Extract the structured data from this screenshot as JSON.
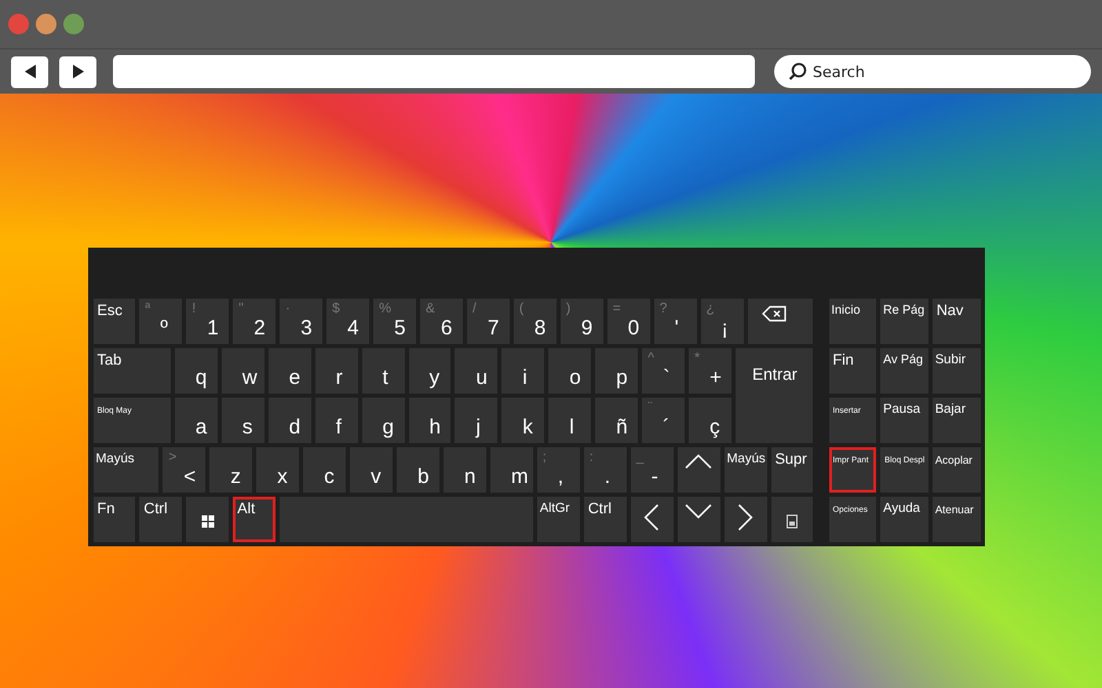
{
  "browser": {
    "search": {
      "placeholder": "Search"
    }
  },
  "keyboard": {
    "main_rows": [
      {
        "keys": [
          {
            "kind": "label",
            "label": "Esc",
            "highlighted": false
          },
          {
            "kind": "char",
            "shift": "ª",
            "main": "º",
            "highlighted": false
          },
          {
            "kind": "char",
            "shift": "!",
            "main": "1",
            "highlighted": false
          },
          {
            "kind": "char",
            "shift": "\"",
            "main": "2",
            "highlighted": false
          },
          {
            "kind": "char",
            "shift": "·",
            "main": "3",
            "highlighted": false
          },
          {
            "kind": "char",
            "shift": "$",
            "main": "4",
            "highlighted": false
          },
          {
            "kind": "char",
            "shift": "%",
            "main": "5",
            "highlighted": false
          },
          {
            "kind": "char",
            "shift": "&",
            "main": "6",
            "highlighted": false
          },
          {
            "kind": "char",
            "shift": "/",
            "main": "7",
            "highlighted": false
          },
          {
            "kind": "char",
            "shift": "(",
            "main": "8",
            "highlighted": false
          },
          {
            "kind": "char",
            "shift": ")",
            "main": "9",
            "highlighted": false
          },
          {
            "kind": "char",
            "shift": "=",
            "main": "0",
            "highlighted": false
          },
          {
            "kind": "char",
            "shift": "?",
            "main": "'",
            "highlighted": false
          },
          {
            "kind": "char",
            "shift": "¿",
            "main": "¡",
            "highlighted": false
          },
          {
            "kind": "backspace",
            "highlighted": false
          }
        ]
      },
      {
        "keys": [
          {
            "kind": "label",
            "label": "Tab",
            "highlighted": false
          },
          {
            "kind": "char",
            "main": "q",
            "highlighted": false
          },
          {
            "kind": "char",
            "main": "w",
            "highlighted": false
          },
          {
            "kind": "char",
            "main": "e",
            "highlighted": false
          },
          {
            "kind": "char",
            "main": "r",
            "highlighted": false
          },
          {
            "kind": "char",
            "main": "t",
            "highlighted": false
          },
          {
            "kind": "char",
            "main": "y",
            "highlighted": false
          },
          {
            "kind": "char",
            "main": "u",
            "highlighted": false
          },
          {
            "kind": "char",
            "main": "i",
            "highlighted": false
          },
          {
            "kind": "char",
            "main": "o",
            "highlighted": false
          },
          {
            "kind": "char",
            "main": "p",
            "highlighted": false
          },
          {
            "kind": "char",
            "shift": "^",
            "main": "`",
            "highlighted": false
          },
          {
            "kind": "char",
            "shift": "*",
            "main": "+",
            "highlighted": false
          },
          {
            "kind": "enter",
            "label": "Entrar",
            "highlighted": false
          }
        ]
      },
      {
        "keys": [
          {
            "kind": "label",
            "label": "Bloq May",
            "highlighted": false
          },
          {
            "kind": "char",
            "main": "a",
            "highlighted": false
          },
          {
            "kind": "char",
            "main": "s",
            "highlighted": false
          },
          {
            "kind": "char",
            "main": "d",
            "highlighted": false
          },
          {
            "kind": "char",
            "main": "f",
            "highlighted": false
          },
          {
            "kind": "char",
            "main": "g",
            "highlighted": false
          },
          {
            "kind": "char",
            "main": "h",
            "highlighted": false
          },
          {
            "kind": "char",
            "main": "j",
            "highlighted": false
          },
          {
            "kind": "char",
            "main": "k",
            "highlighted": false
          },
          {
            "kind": "char",
            "main": "l",
            "highlighted": false
          },
          {
            "kind": "char",
            "main": "ñ",
            "highlighted": false
          },
          {
            "kind": "char",
            "shift": "¨",
            "main": "´",
            "highlighted": false
          },
          {
            "kind": "char",
            "main": "ç",
            "highlighted": false
          }
        ]
      },
      {
        "keys": [
          {
            "kind": "label",
            "label": "Mayús",
            "highlighted": false
          },
          {
            "kind": "char",
            "shift": ">",
            "main": "<",
            "highlighted": false
          },
          {
            "kind": "char",
            "main": "z",
            "highlighted": false
          },
          {
            "kind": "char",
            "main": "x",
            "highlighted": false
          },
          {
            "kind": "char",
            "main": "c",
            "highlighted": false
          },
          {
            "kind": "char",
            "main": "v",
            "highlighted": false
          },
          {
            "kind": "char",
            "main": "b",
            "highlighted": false
          },
          {
            "kind": "char",
            "main": "n",
            "highlighted": false
          },
          {
            "kind": "char",
            "main": "m",
            "highlighted": false
          },
          {
            "kind": "char",
            "shift": ";",
            "main": ",",
            "highlighted": false
          },
          {
            "kind": "char",
            "shift": ":",
            "main": ".",
            "highlighted": false
          },
          {
            "kind": "char",
            "shift": "_",
            "main": "-",
            "highlighted": false
          },
          {
            "kind": "up",
            "highlighted": false
          },
          {
            "kind": "label",
            "label": "Mayús",
            "highlighted": false
          },
          {
            "kind": "label",
            "label": "Supr",
            "highlighted": false
          }
        ]
      },
      {
        "keys": [
          {
            "kind": "label",
            "label": "Fn",
            "highlighted": false
          },
          {
            "kind": "label",
            "label": "Ctrl",
            "highlighted": false
          },
          {
            "kind": "windows",
            "highlighted": false
          },
          {
            "kind": "label",
            "label": "Alt",
            "highlighted": true
          },
          {
            "kind": "space",
            "highlighted": false
          },
          {
            "kind": "label",
            "label": "AltGr",
            "highlighted": false
          },
          {
            "kind": "label",
            "label": "Ctrl",
            "highlighted": false
          },
          {
            "kind": "left",
            "highlighted": false
          },
          {
            "kind": "down",
            "highlighted": false
          },
          {
            "kind": "right",
            "highlighted": false
          },
          {
            "kind": "menu",
            "highlighted": false
          }
        ]
      }
    ],
    "nav_rows": [
      {
        "keys": [
          {
            "kind": "label",
            "label": "Inicio",
            "highlighted": false
          },
          {
            "kind": "label",
            "label": "Re Pág",
            "highlighted": false
          },
          {
            "kind": "label",
            "label": "Nav",
            "highlighted": false
          }
        ]
      },
      {
        "keys": [
          {
            "kind": "label",
            "label": "Fin",
            "highlighted": false
          },
          {
            "kind": "label",
            "label": "Av Pág",
            "highlighted": false
          },
          {
            "kind": "label",
            "label": "Subir",
            "highlighted": false
          }
        ]
      },
      {
        "keys": [
          {
            "kind": "label",
            "label": "Insertar",
            "highlighted": false
          },
          {
            "kind": "label",
            "label": "Pausa",
            "highlighted": false
          },
          {
            "kind": "label",
            "label": "Bajar",
            "highlighted": false
          }
        ]
      },
      {
        "keys": [
          {
            "kind": "label",
            "label": "Impr Pant",
            "highlighted": true
          },
          {
            "kind": "label",
            "label": "Bloq Despl",
            "highlighted": false
          },
          {
            "kind": "label",
            "label": "Acoplar",
            "highlighted": false
          }
        ]
      },
      {
        "keys": [
          {
            "kind": "label",
            "label": "Opciones",
            "highlighted": false
          },
          {
            "kind": "label",
            "label": "Ayuda",
            "highlighted": false
          },
          {
            "kind": "label",
            "label": "Atenuar",
            "highlighted": false
          }
        ]
      }
    ]
  }
}
